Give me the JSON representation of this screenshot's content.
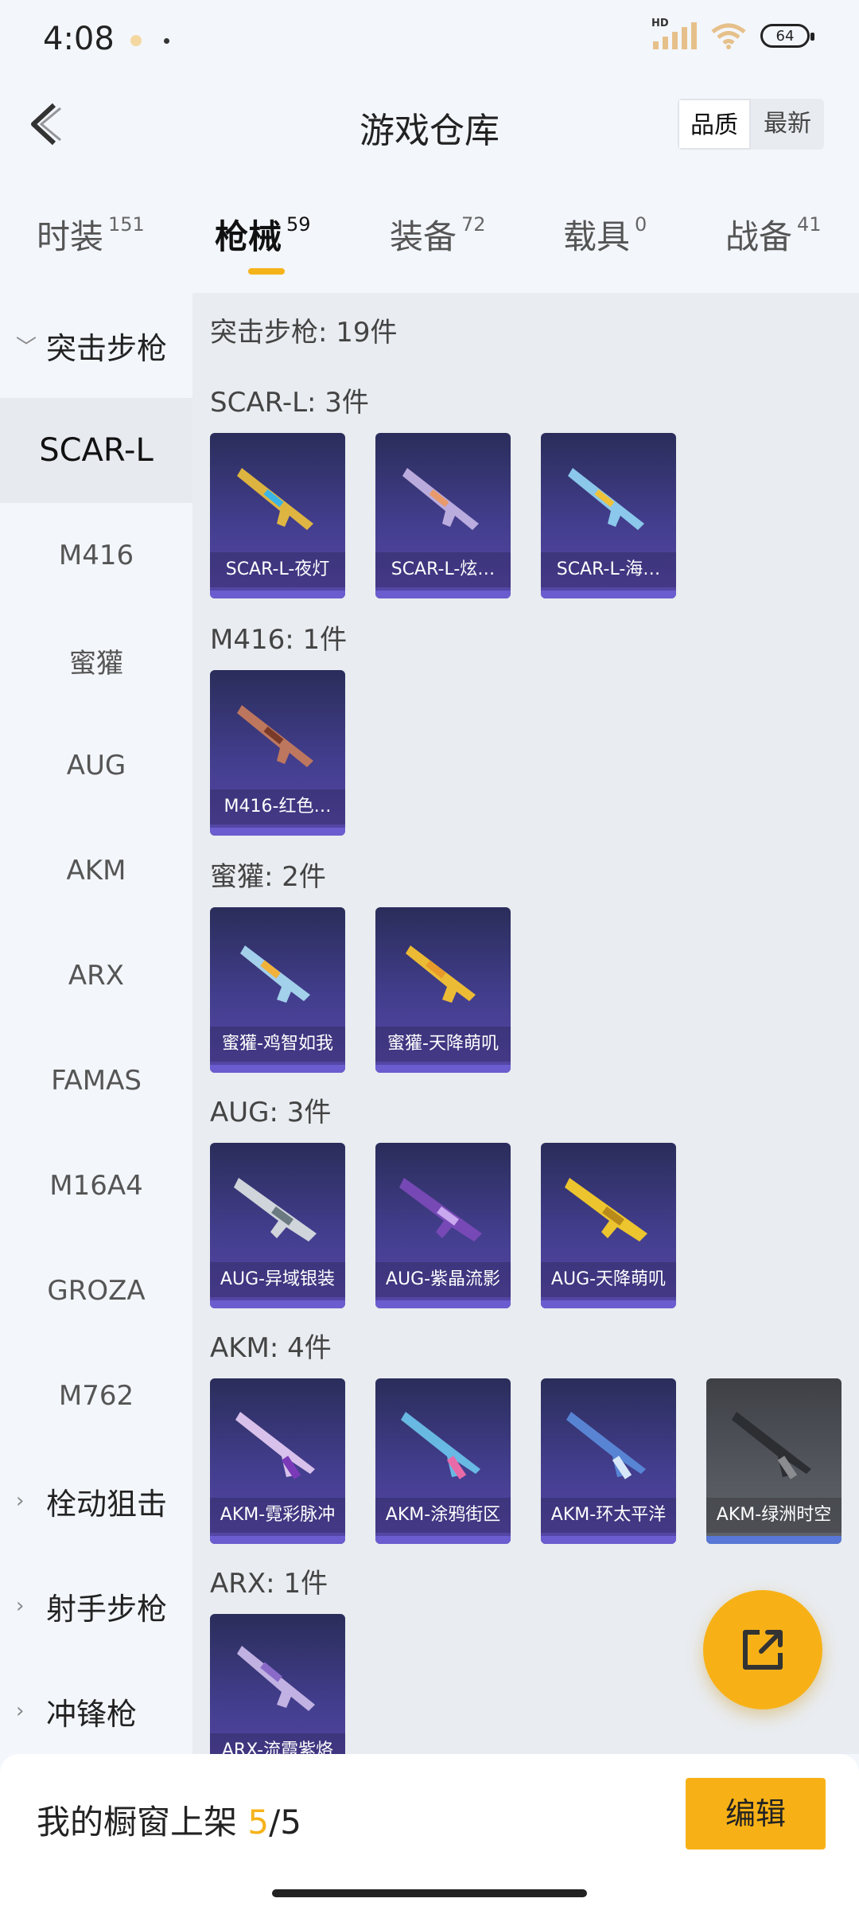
{
  "status": {
    "time": "4:08",
    "battery": "64",
    "signal_badge": "HD"
  },
  "header": {
    "title": "游戏仓库",
    "sort_options": [
      "品质",
      "最新"
    ],
    "selected_sort": "品质"
  },
  "tabs": [
    {
      "label": "时装",
      "count": "151"
    },
    {
      "label": "枪械",
      "count": "59"
    },
    {
      "label": "装备",
      "count": "72"
    },
    {
      "label": "载具",
      "count": "0"
    },
    {
      "label": "战备",
      "count": "41"
    }
  ],
  "active_tab": "枪械",
  "sidebar": {
    "expanded_category": "突击步枪",
    "subcategories": [
      "SCAR-L",
      "M416",
      "蜜獾",
      "AUG",
      "AKM",
      "ARX",
      "FAMAS",
      "M16A4",
      "GROZA",
      "M762"
    ],
    "active_subcategory": "SCAR-L",
    "collapsed_categories": [
      "栓动狙击",
      "射手步枪",
      "冲锋枪"
    ]
  },
  "main": {
    "total": "突击步枪: 19件",
    "groups": [
      {
        "title": "SCAR-L: 3件",
        "items": [
          "SCAR-L-夜灯",
          "SCAR-L-炫…",
          "SCAR-L-海…"
        ]
      },
      {
        "title": "M416: 1件",
        "items": [
          "M416-红色…"
        ]
      },
      {
        "title": "蜜獾: 2件",
        "items": [
          "蜜獾-鸡智如我",
          "蜜獾-天降萌叽"
        ]
      },
      {
        "title": "AUG: 3件",
        "items": [
          "AUG-异域银装",
          "AUG-紫晶流影",
          "AUG-天降萌叽"
        ]
      },
      {
        "title": "AKM: 4件",
        "items": [
          "AKM-霓彩脉冲",
          "AKM-涂鸦街区",
          "AKM-环太平洋",
          "AKM-绿洲时空"
        ]
      },
      {
        "title": "ARX: 1件",
        "items": [
          "ARX-流霞紫烙"
        ]
      }
    ]
  },
  "bottom": {
    "shelf_label": "我的橱窗上架",
    "shelf_count": "5",
    "shelf_total": "/5",
    "edit_label": "编辑"
  },
  "colors": {
    "accent": "#f7b117",
    "card_purple": "#433e8e",
    "card_grey": "#55585f"
  },
  "icons": {
    "back": "chevron-left-icon",
    "share": "share-external-icon"
  }
}
